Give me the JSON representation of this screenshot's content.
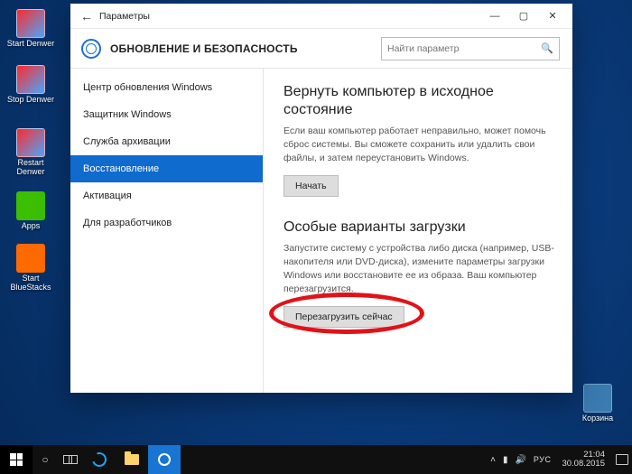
{
  "desktop_icons": [
    {
      "label": "Start Denwer"
    },
    {
      "label": "Stop Denwer"
    },
    {
      "label": "Restart Denwer"
    },
    {
      "label": "Apps"
    },
    {
      "label": "Start BlueStacks"
    }
  ],
  "recycle_bin_label": "Корзина",
  "settings": {
    "window_title": "Параметры",
    "section_title": "ОБНОВЛЕНИЕ И БЕЗОПАСНОСТЬ",
    "search_placeholder": "Найти параметр",
    "sidebar": {
      "items": [
        {
          "label": "Центр обновления Windows"
        },
        {
          "label": "Защитник Windows"
        },
        {
          "label": "Служба архивации"
        },
        {
          "label": "Восстановление"
        },
        {
          "label": "Активация"
        },
        {
          "label": "Для разработчиков"
        }
      ],
      "selected_index": 3
    },
    "content": {
      "reset_heading": "Вернуть компьютер в исходное состояние",
      "reset_desc": "Если ваш компьютер работает неправильно, может помочь сброс системы. Вы сможете сохранить или удалить свои файлы, и затем переустановить Windows.",
      "reset_button": "Начать",
      "advanced_heading": "Особые варианты загрузки",
      "advanced_desc": "Запустите систему с устройства либо диска (например, USB-накопителя или DVD-диска), измените параметры загрузки Windows или восстановите ее из образа. Ваш компьютер перезагрузится.",
      "advanced_button": "Перезагрузить сейчас"
    }
  },
  "taskbar": {
    "lang": "РУС",
    "time": "21:04",
    "date": "30.08.2015"
  }
}
